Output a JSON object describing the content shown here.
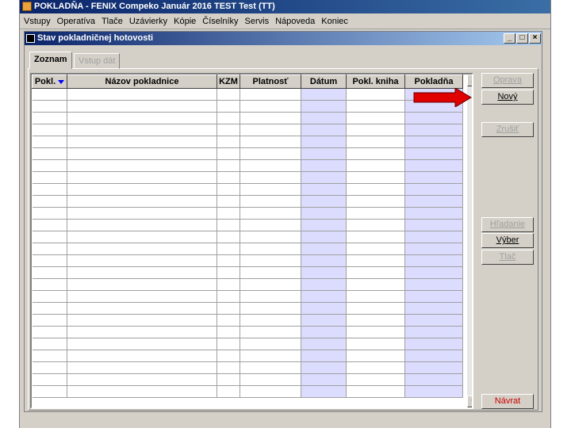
{
  "app": {
    "title": "POKLADŇA - FENIX Compeko  Január 2016  TEST Test  (TT)"
  },
  "menu": [
    "Vstupy",
    "Operatíva",
    "Tlače",
    "Uzávierky",
    "Kópie",
    "Číselníky",
    "Servis",
    "Nápoveda",
    "Koniec"
  ],
  "window": {
    "title": "Stav pokladničnej hotovosti",
    "minimize": "_",
    "maximize": "□",
    "close": "×"
  },
  "tabs": {
    "active": "Zoznam",
    "inactive": "Vstup dát"
  },
  "grid": {
    "columns": [
      "Pokl.",
      "Názov pokladnice",
      "KZM",
      "Platnosť",
      "Dátum",
      "Pokl. kniha",
      "Pokladňa"
    ],
    "sorted_column": "Pokl.",
    "row_count": 26
  },
  "buttons": {
    "oprava": "Oprava",
    "novy": "Nový",
    "zrusit": "Zrušiť",
    "hladanie": "Hľadanie",
    "vyber": "Výber",
    "tlac": "Tlač",
    "navrat": "Návrat"
  },
  "colors": {
    "highlight_column": "#dcdcff",
    "navrat_text": "#cc0000",
    "arrow": "#e00000"
  }
}
